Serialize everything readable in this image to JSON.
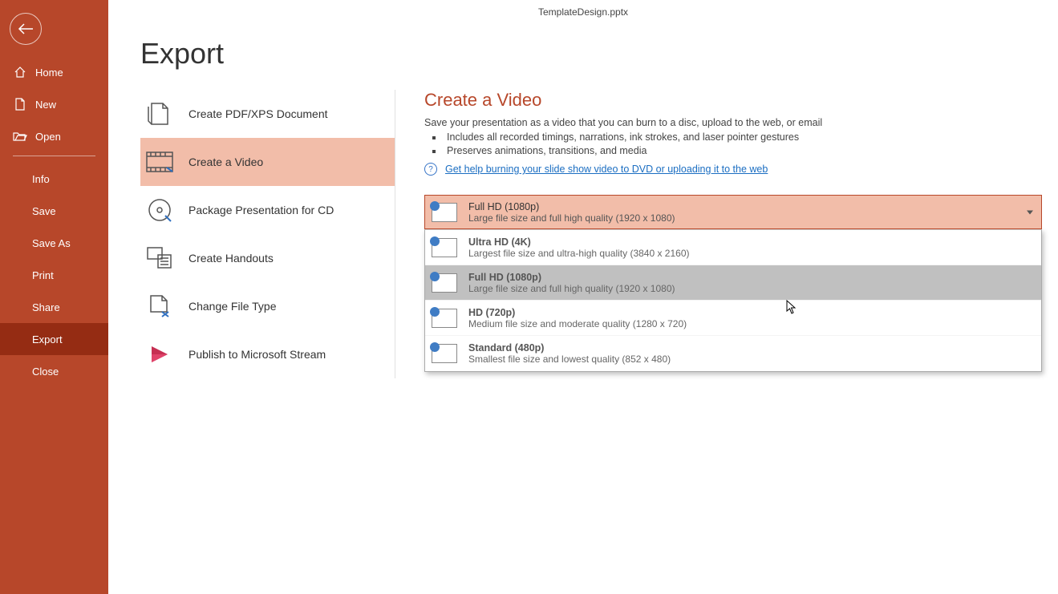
{
  "titlebar": {
    "filename": "TemplateDesign.pptx"
  },
  "page": {
    "title": "Export"
  },
  "sidebar": {
    "home": "Home",
    "new": "New",
    "open": "Open",
    "info": "Info",
    "save": "Save",
    "saveas": "Save As",
    "print": "Print",
    "share": "Share",
    "export": "Export",
    "close": "Close"
  },
  "options": [
    {
      "label": "Create PDF/XPS Document"
    },
    {
      "label": "Create a Video"
    },
    {
      "label": "Package Presentation for CD"
    },
    {
      "label": "Create Handouts"
    },
    {
      "label": "Change File Type"
    },
    {
      "label": "Publish to Microsoft Stream"
    }
  ],
  "detail": {
    "title": "Create a Video",
    "subtitle": "Save your presentation as a video that you can burn to a disc, upload to the web, or email",
    "bullets": [
      "Includes all recorded timings, narrations, ink strokes, and laser pointer gestures",
      "Preserves animations, transitions, and media"
    ],
    "help": "Get help burning your slide show video to DVD or uploading it to the web"
  },
  "dropdown": {
    "selected": {
      "title": "Full HD (1080p)",
      "desc": "Large file size and full high quality (1920 x 1080)"
    },
    "items": [
      {
        "title": "Ultra HD (4K)",
        "desc": "Largest file size and ultra-high quality (3840 x 2160)"
      },
      {
        "title": "Full HD (1080p)",
        "desc": "Large file size and full high quality (1920 x 1080)"
      },
      {
        "title": "HD (720p)",
        "desc": "Medium file size and moderate quality (1280 x 720)"
      },
      {
        "title": "Standard (480p)",
        "desc": "Smallest file size and lowest quality (852 x 480)"
      }
    ]
  }
}
